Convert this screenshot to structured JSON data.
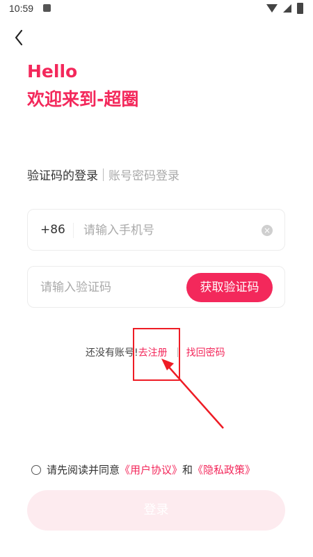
{
  "status_bar": {
    "time": "10:59",
    "icons": [
      "notification-a-icon",
      "wifi-icon",
      "signal-icon",
      "battery-icon"
    ]
  },
  "header": {
    "back_icon": "chevron-left-icon",
    "greeting": "Hello",
    "welcome": "欢迎来到-超圈"
  },
  "login_tabs": {
    "active": "验证码的登录",
    "inactive": "账号密码登录"
  },
  "phone_field": {
    "country_code": "+86",
    "placeholder": "请输入手机号",
    "value": "",
    "clear_icon": "clear-circle-icon"
  },
  "code_field": {
    "placeholder": "请输入验证码",
    "value": "",
    "get_code_label": "获取验证码"
  },
  "links": {
    "no_account": "还没有账号!",
    "register": "去注册",
    "find_password": "找回密码"
  },
  "agreement": {
    "prefix": "请先阅读并同意",
    "user_agreement": "《用户协议》",
    "and": "和",
    "privacy_policy": "《隐私政策》"
  },
  "login_button": {
    "label": "登录"
  },
  "colors": {
    "accent": "#f3285b",
    "annotation": "#ee1c25",
    "login_disabled_bg": "#fdebef"
  }
}
